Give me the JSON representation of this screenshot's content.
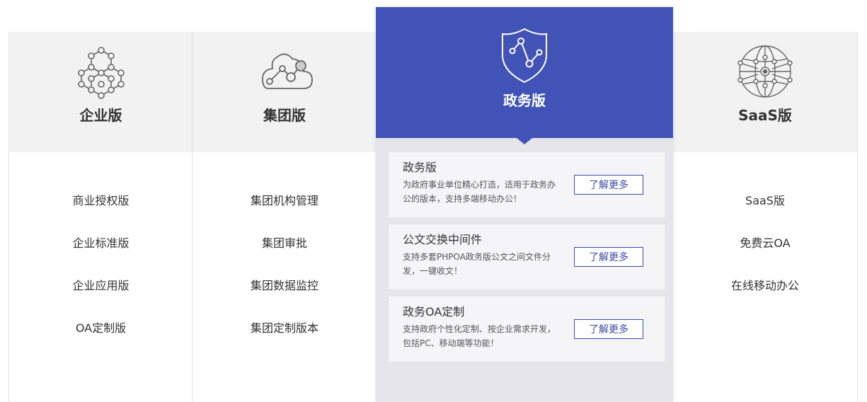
{
  "columns": [
    {
      "title": "企业版",
      "icon": "hex-network-icon",
      "items": [
        "商业授权版",
        "企业标准版",
        "企业应用版",
        "OA定制版"
      ]
    },
    {
      "title": "集团版",
      "icon": "cloud-nodes-icon",
      "items": [
        "集团机构管理",
        "集团审批",
        "集团数据监控",
        "集团定制版本"
      ]
    },
    {
      "title": "SaaS版",
      "icon": "globe-network-icon",
      "items": [
        "SaaS版",
        "免费云OA",
        "在线移动办公"
      ]
    }
  ],
  "featured": {
    "title": "政务版",
    "icon": "shield-icon",
    "cards": [
      {
        "title": "政务版",
        "desc": "为政府事业单位精心打造，适用于政务办公的版本，支持多端移动办公！",
        "button": "了解更多"
      },
      {
        "title": "公文交换中间件",
        "desc": "支持多套PHPOA政务版公文之间文件分发，一键收文！",
        "button": "了解更多"
      },
      {
        "title": "政务OA定制",
        "desc": "支持政府个性化定制、按企业需求开发，包括PC、移动端等功能！",
        "button": "了解更多"
      }
    ]
  },
  "colors": {
    "accent": "#4253b8",
    "header_bg": "#f2f2f2",
    "featured_bg": "#e5e5ea"
  }
}
